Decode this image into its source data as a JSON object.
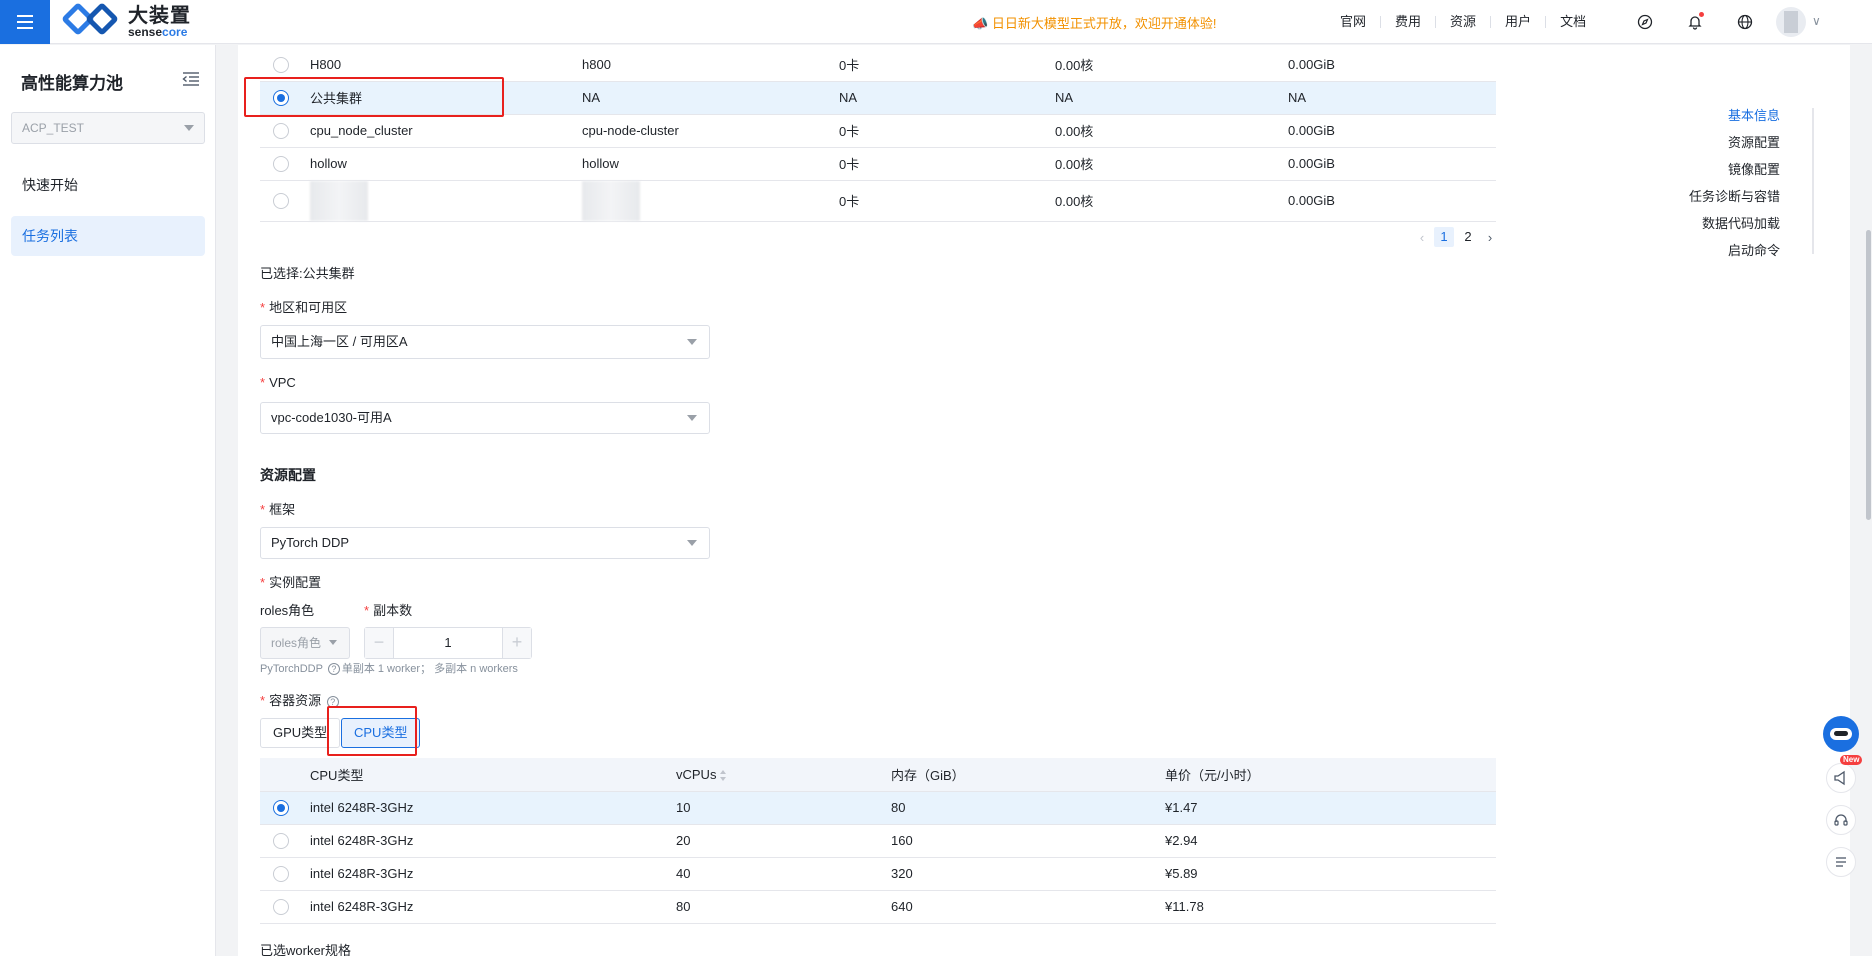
{
  "header": {
    "logo_cn": "大装置",
    "logo_en_a": "sense",
    "logo_en_b": "core",
    "notice": "日日新大模型正式开放，欢迎开通体验!",
    "nav": [
      "官网",
      "费用",
      "资源",
      "用户",
      "文档"
    ]
  },
  "sidebar": {
    "title": "高性能算力池",
    "workspace": "ACP_TEST",
    "items": [
      {
        "label": "快速开始"
      },
      {
        "label": "任务列表"
      }
    ]
  },
  "cluster_table": {
    "rows": [
      {
        "name": "H800",
        "id": "h800",
        "cards": "0卡",
        "cores": "0.00核",
        "mem": "0.00GiB"
      },
      {
        "name": "公共集群",
        "id": "NA",
        "cards": "NA",
        "cores": "NA",
        "mem": "NA"
      },
      {
        "name": "cpu_node_cluster",
        "id": "cpu-node-cluster",
        "cards": "0卡",
        "cores": "0.00核",
        "mem": "0.00GiB"
      },
      {
        "name": "hollow",
        "id": "hollow",
        "cards": "0卡",
        "cores": "0.00核",
        "mem": "0.00GiB"
      },
      {
        "name": "",
        "id": "",
        "cards": "0卡",
        "cores": "0.00核",
        "mem": "0.00GiB"
      }
    ],
    "pagination": {
      "pages": [
        "1",
        "2"
      ],
      "current": "1"
    }
  },
  "form": {
    "selected_cluster": "已选择:公共集群",
    "region_label": "地区和可用区",
    "region_value": "中国上海一区 / 可用区A",
    "vpc_label": "VPC",
    "vpc_value": "vpc-code1030-可用A",
    "resource_section": "资源配置",
    "framework_label": "框架",
    "framework_value": "PyTorch DDP",
    "instance_label": "实例配置",
    "roles_label": "roles角色",
    "roles_placeholder": "roles角色",
    "replicas_label": "副本数",
    "replicas_value": "1",
    "hint_prefix": "PyTorchDDP",
    "hint_text": "单副本 1 worker； 多副本 n workers",
    "container_label": "容器资源",
    "tab_gpu": "GPU类型",
    "tab_cpu": "CPU类型",
    "footer_label": "已选worker规格"
  },
  "cpu_table": {
    "headers": [
      "CPU类型",
      "vCPUs",
      "内存（GiB）",
      "单价（元/小时）"
    ],
    "rows": [
      {
        "type": "intel 6248R-3GHz",
        "vcpus": "10",
        "mem": "80",
        "price": "¥1.47"
      },
      {
        "type": "intel 6248R-3GHz",
        "vcpus": "20",
        "mem": "160",
        "price": "¥2.94"
      },
      {
        "type": "intel 6248R-3GHz",
        "vcpus": "40",
        "mem": "320",
        "price": "¥5.89"
      },
      {
        "type": "intel 6248R-3GHz",
        "vcpus": "80",
        "mem": "640",
        "price": "¥11.78"
      }
    ]
  },
  "anchors": [
    "基本信息",
    "资源配置",
    "镜像配置",
    "任务诊断与容错",
    "数据代码加载",
    "启动命令"
  ],
  "floating": {
    "new_badge": "New"
  },
  "colors": {
    "primary": "#1a6fe0",
    "highlight": "#e8201d",
    "notice": "#f29100"
  }
}
